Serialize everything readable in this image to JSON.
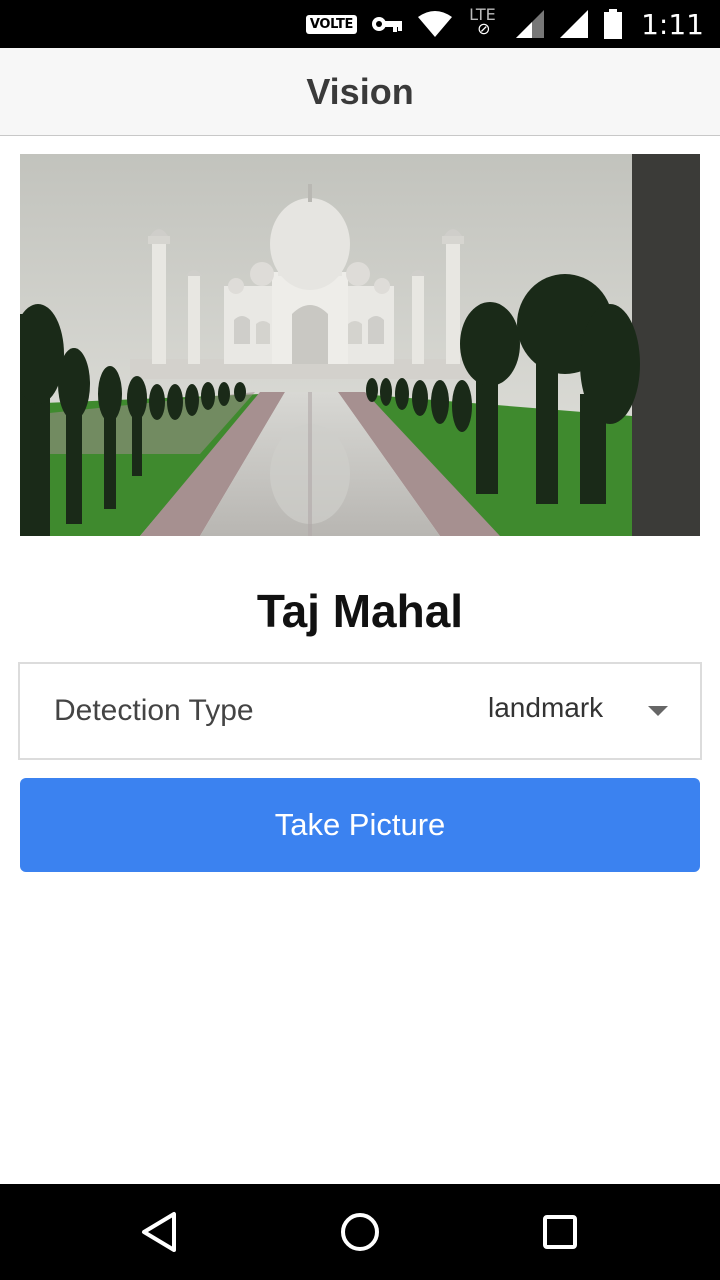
{
  "status_bar": {
    "volte_label": "VOLTE",
    "network_label": "LTE",
    "time": "1:11",
    "icons": [
      "vpn-key-icon",
      "wifi-icon",
      "signal-icon",
      "battery-icon"
    ]
  },
  "app_bar": {
    "title": "Vision"
  },
  "photo": {
    "subject": "Taj Mahal"
  },
  "result": {
    "label": "Taj Mahal"
  },
  "picker": {
    "label": "Detection Type",
    "selected_value": "landmark"
  },
  "take_picture_button": {
    "label": "Take Picture"
  },
  "nav_bar": {
    "icons": [
      "back-icon",
      "home-icon",
      "recents-icon"
    ]
  },
  "colors": {
    "accent": "#3b82f0",
    "app_bar_bg": "#f7f7f7",
    "status_bar_bg": "#000000"
  }
}
